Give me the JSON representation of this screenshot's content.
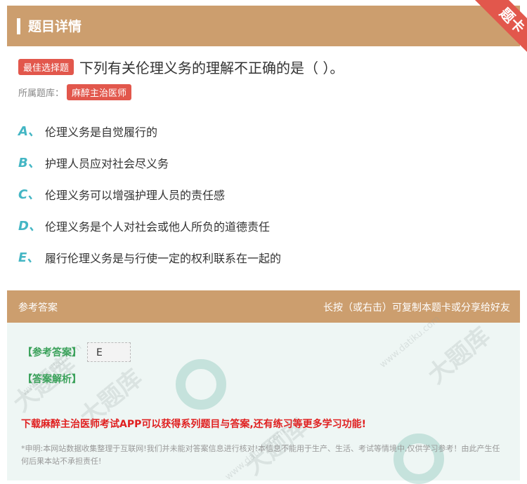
{
  "header": {
    "title": "题目详情",
    "corner_label": "题卡"
  },
  "question": {
    "type_tag": "最佳选择题",
    "text": "下列有关伦理义务的理解不正确的是（ ）。",
    "bank_label": "所属题库：",
    "bank_name": "麻醉主治医师"
  },
  "options": [
    {
      "letter": "A、",
      "text": "伦理义务是自觉履行的"
    },
    {
      "letter": "B、",
      "text": "护理人员应对社会尽义务"
    },
    {
      "letter": "C、",
      "text": "伦理义务可以增强护理人员的责任感"
    },
    {
      "letter": "D、",
      "text": "伦理义务是个人对社会或他人所负的道德责任"
    },
    {
      "letter": "E、",
      "text": "履行伦理义务是与行使一定的权利联系在一起的"
    }
  ],
  "answer_section": {
    "title": "参考答案",
    "hint": "长按（或右击）可复制本题卡或分享给好友",
    "ref_label": "【参考答案】",
    "ref_value": "E",
    "analysis_label": "【答案解析】",
    "download_text": "下载麻醉主治医师考试APP可以获得系列题目与答案,还有练习等更多学习功能!",
    "disclaimer": "*申明:本网站数据收集整理于互联网!我们并未能对答案信息进行核对!本信息不能用于生产、生活、考试等情境中,仅供学习参考！由此产生任何后果本站不承担责任!"
  },
  "colors": {
    "header_bg": "#cc9e6e",
    "tag_red": "#e2574c",
    "option_letter": "#44b6c4",
    "answer_bg": "#eef6f4"
  },
  "watermarks": [
    "大题库",
    "www.datiku.com"
  ]
}
